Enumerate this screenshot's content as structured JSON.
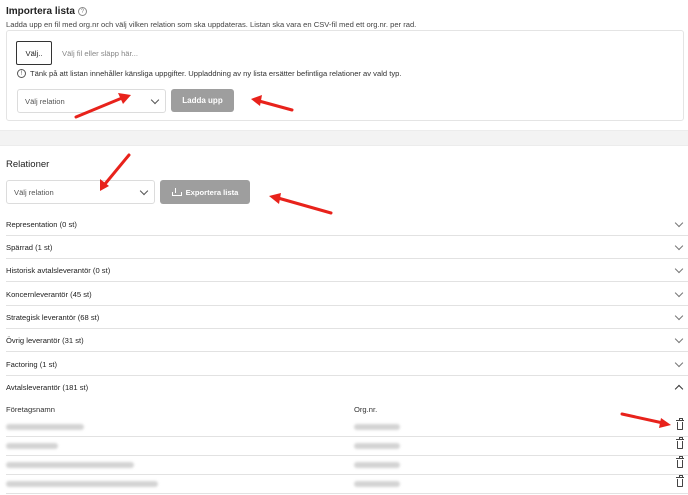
{
  "import": {
    "title": "Importera lista",
    "help_icon": "help-circle-icon",
    "description": "Ladda upp en fil med org.nr och välj vilken relation som ska uppdateras. Listan ska vara en CSV-fil med ett org.nr. per rad.",
    "file_button": "Välj..",
    "file_placeholder": "Välj fil eller släpp här...",
    "warning_icon": "warning-circle-icon",
    "warning": "Tänk på att listan innehåller känsliga uppgifter. Uppladdning av ny lista ersätter befintliga relationer av vald typ.",
    "relation_select": "Välj relation",
    "upload_button": "Ladda upp"
  },
  "relations": {
    "title": "Relationer",
    "relation_select": "Välj relation",
    "export_button": "Exportera lista",
    "export_icon": "download-icon",
    "groups": [
      {
        "label": "Representation (0 st)",
        "expanded": false
      },
      {
        "label": "Spärrad (1 st)",
        "expanded": false
      },
      {
        "label": "Historisk avtalsleverantör (0 st)",
        "expanded": false
      },
      {
        "label": "Koncernleverantör (45 st)",
        "expanded": false
      },
      {
        "label": "Strategisk leverantör (68 st)",
        "expanded": false
      },
      {
        "label": "Övrig leverantör (31 st)",
        "expanded": false
      },
      {
        "label": "Factoring (1 st)",
        "expanded": false
      },
      {
        "label": "Avtalsleverantör (181 st)",
        "expanded": true
      }
    ],
    "table": {
      "columns": [
        "Företagsnamn",
        "Org.nr."
      ],
      "row_action_icon": "trash-icon",
      "rows_note": "rows are blurred/redacted in screenshot"
    }
  },
  "colors": {
    "annotation_arrow": "#e8221b",
    "button_disabled": "#9e9e9e",
    "divider_band": "#f3f3f3"
  }
}
